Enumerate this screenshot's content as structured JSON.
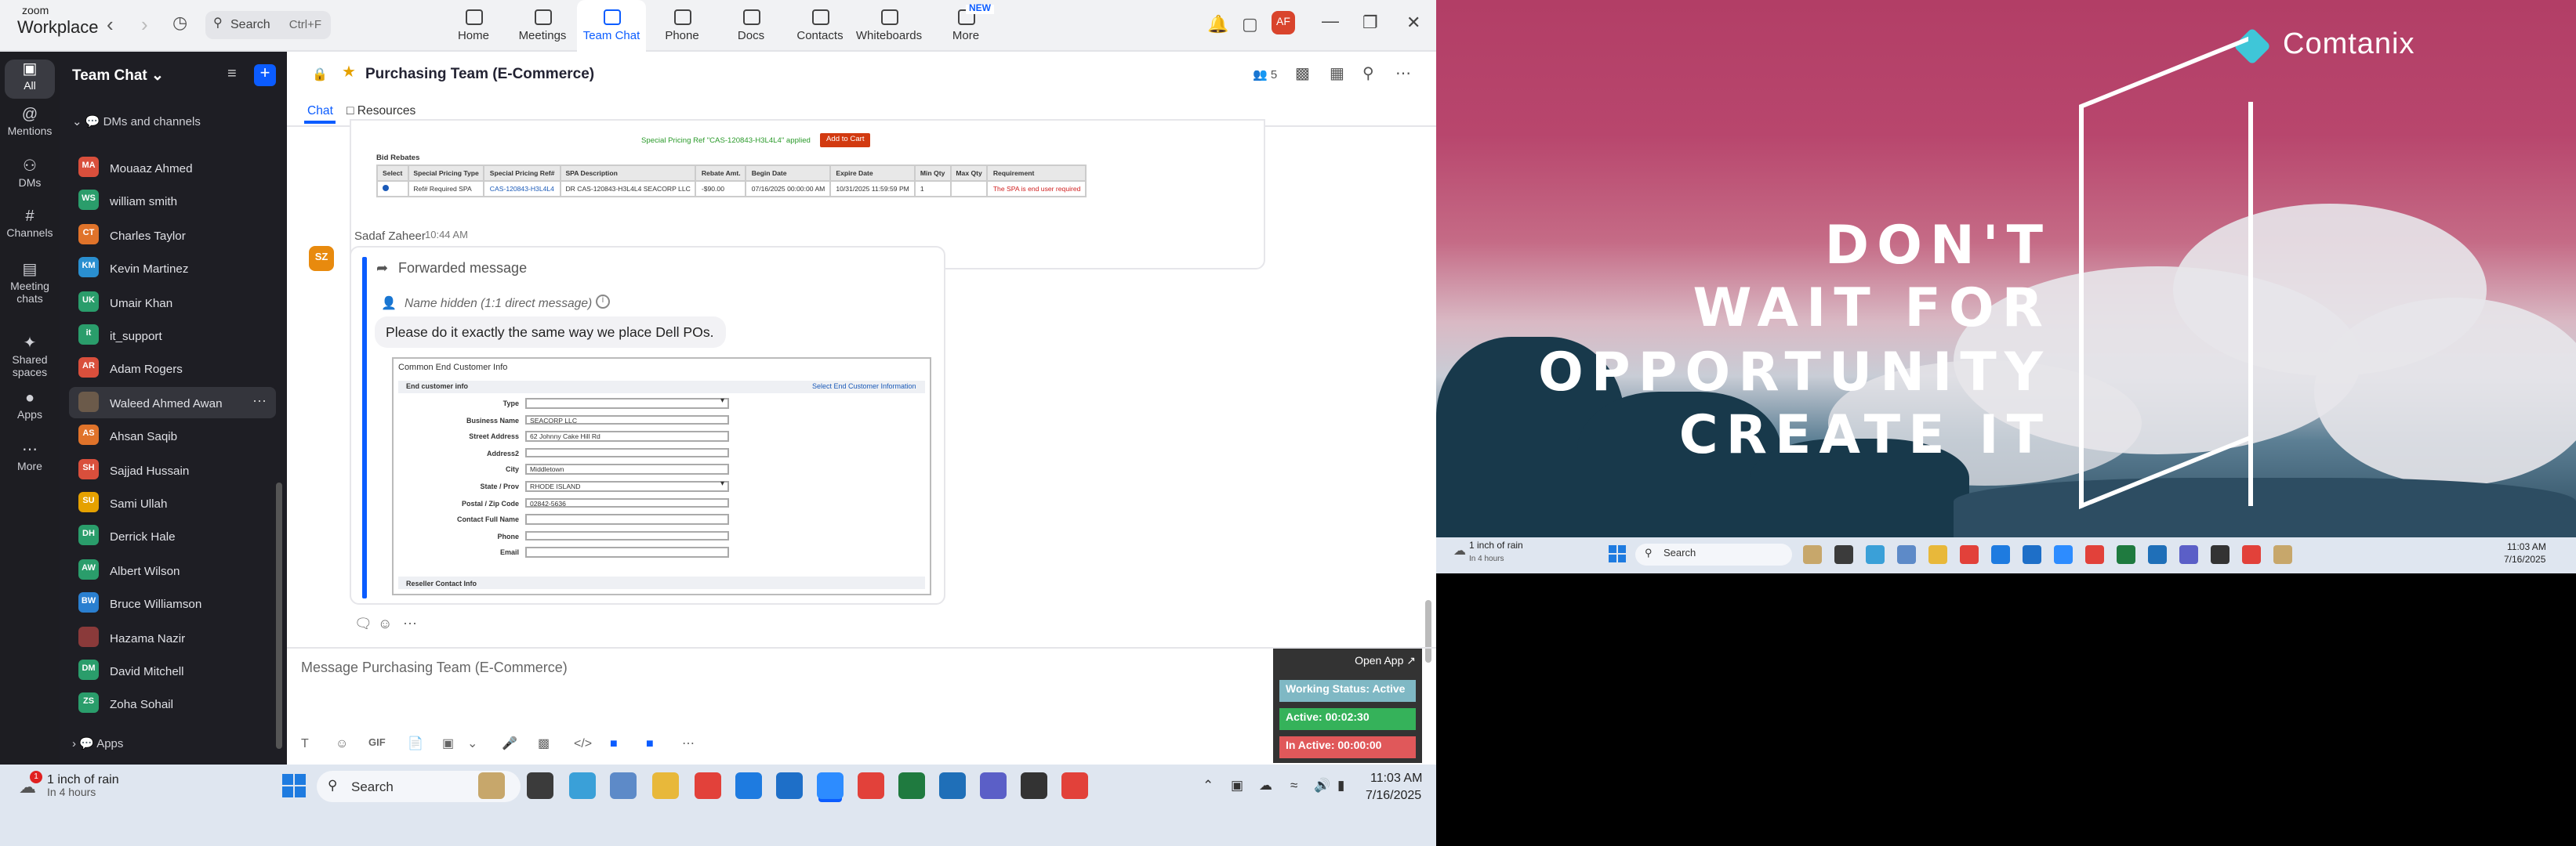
{
  "titlebar": {
    "logo_line1": "zoom",
    "logo_line2": "Workplace",
    "search_placeholder": "Search",
    "search_shortcut": "Ctrl+F",
    "tabs": [
      {
        "label": "Home",
        "icon": "home-icon"
      },
      {
        "label": "Meetings",
        "icon": "video-icon"
      },
      {
        "label": "Team Chat",
        "icon": "chat-icon",
        "active": true
      },
      {
        "label": "Phone",
        "icon": "phone-icon"
      },
      {
        "label": "Docs",
        "icon": "docs-icon"
      },
      {
        "label": "Contacts",
        "icon": "contacts-icon"
      },
      {
        "label": "Whiteboards",
        "icon": "whiteboard-icon"
      },
      {
        "label": "More",
        "icon": "more-icon"
      }
    ],
    "new_badge": "NEW",
    "avatar_initials": "AF"
  },
  "rail": [
    {
      "label": "All",
      "icon": "chat-bubble-icon",
      "active": true
    },
    {
      "label": "Mentions",
      "icon": "at-icon"
    },
    {
      "label": "DMs",
      "icon": "people-icon"
    },
    {
      "label": "Channels",
      "icon": "hash-icon"
    },
    {
      "label": "Meeting chats",
      "icon": "calendar-icon"
    },
    {
      "label": "Shared spaces",
      "icon": "shared-icon"
    },
    {
      "label": "Apps",
      "icon": "apps-icon"
    },
    {
      "label": "More",
      "icon": "more-icon"
    }
  ],
  "sidebar": {
    "title": "Team Chat",
    "section": "DMs and channels",
    "apps_label": "Apps",
    "items": [
      {
        "name": "Mouaaz Ahmed",
        "initials": "MA",
        "color": "#d94f3c"
      },
      {
        "name": "william smith",
        "initials": "WS",
        "color": "#2a9d6b"
      },
      {
        "name": "Charles Taylor",
        "initials": "CT",
        "color": "#e0732a"
      },
      {
        "name": "Kevin Martinez",
        "initials": "KM",
        "color": "#2a8fd0"
      },
      {
        "name": "Umair Khan",
        "initials": "UK",
        "color": "#2a9d6b"
      },
      {
        "name": "it_support",
        "initials": "it",
        "color": "#2a9d6b"
      },
      {
        "name": "Adam Rogers",
        "initials": "AR",
        "color": "#d94f3c"
      },
      {
        "name": "Waleed Ahmed Awan",
        "initials": "",
        "color": "#6b5a4a",
        "selected": true
      },
      {
        "name": "Ahsan Saqib",
        "initials": "AS",
        "color": "#e0732a"
      },
      {
        "name": "Sajjad Hussain",
        "initials": "SH",
        "color": "#d94f3c"
      },
      {
        "name": "Sami Ullah",
        "initials": "SU",
        "color": "#e5a100"
      },
      {
        "name": "Derrick Hale",
        "initials": "DH",
        "color": "#2a9d6b"
      },
      {
        "name": "Albert Wilson",
        "initials": "AW",
        "color": "#2a9d6b"
      },
      {
        "name": "Bruce Williamson",
        "initials": "BW",
        "color": "#2a7fd0"
      },
      {
        "name": "Hazama Nazir",
        "initials": "",
        "color": "#8a3a3a"
      },
      {
        "name": "David Mitchell",
        "initials": "DM",
        "color": "#2a9d6b"
      },
      {
        "name": "Zoha Sohail",
        "initials": "ZS",
        "color": "#2a9d6b"
      }
    ]
  },
  "chat": {
    "title": "Purchasing Team (E-Commerce)",
    "member_count": "5",
    "tabs": [
      "Chat",
      "Resources"
    ],
    "old_card": {
      "special_pricing": "Special Pricing Ref \"CAS-120843-H3L4L4\" applied",
      "add_to_cart": "Add to Cart",
      "bid_rebates": "Bid Rebates",
      "headers": [
        "Select",
        "Special Pricing Type",
        "Special Pricing Ref#",
        "SPA Description",
        "Rebate Amt.",
        "Begin Date",
        "Expire Date",
        "Min Qty",
        "Max Qty",
        "Requirement"
      ],
      "row": [
        "",
        "Ref# Required SPA",
        "CAS-120843-H3L4L4",
        "DR CAS-120843-H3L4L4 SEACORP LLC",
        "-$90.00",
        "07/16/2025 00:00:00 AM",
        "10/31/2025 11:59:59 PM",
        "1",
        "",
        "The SPA is end user required"
      ]
    },
    "message": {
      "sender": "Sadaf Zaheer",
      "time": "10:44 AM",
      "avatar": "SZ",
      "forwarded_label": "Forwarded message",
      "hidden_name": "Name hidden (1:1 direct message)",
      "text": "Please do it exactly the same way we place Dell POs.",
      "form": {
        "title": "Common End Customer Info",
        "section": "End customer info",
        "link": "Select End Customer Information",
        "fields": [
          {
            "label": "Type",
            "value": "",
            "dropdown": true
          },
          {
            "label": "Business Name",
            "value": "SEACORP LLC"
          },
          {
            "label": "Street Address",
            "value": "62 Johnny Cake Hill Rd"
          },
          {
            "label": "Address2",
            "value": ""
          },
          {
            "label": "City",
            "value": "Middletown"
          },
          {
            "label": "State / Prov",
            "value": "RHODE ISLAND",
            "dropdown": true
          },
          {
            "label": "Postal / Zip Code",
            "value": "02842-5636"
          },
          {
            "label": "Contact Full Name",
            "value": ""
          },
          {
            "label": "Phone",
            "value": ""
          },
          {
            "label": "Email",
            "value": ""
          }
        ],
        "reseller": "Reseller Contact Info"
      }
    },
    "composer_placeholder": "Message Purchasing Team (E-Commerce)",
    "format_gif": "GIF"
  },
  "work_status": {
    "open_app": "Open App ↗",
    "status": "Working Status: Active",
    "active": "Active: 00:02:30",
    "inactive": "In Active: 00:00:00",
    "status_color": "#7fb8c4",
    "active_color": "#35b25a",
    "inactive_color": "#e0585a"
  },
  "taskbar": {
    "weather_line1": "1 inch of rain",
    "weather_line2": "In 4 hours",
    "weather_badge": "1",
    "search": "Search",
    "time": "11:03 AM",
    "date": "7/16/2025"
  },
  "wallpaper": {
    "brand": "Comtanix",
    "quote": [
      "DON'T",
      "WAIT FOR",
      "OPPORTUNITY",
      "CREATE IT"
    ]
  },
  "right_taskbar": {
    "weather_line1": "1 inch of rain",
    "weather_line2": "In 4 hours",
    "search": "Search",
    "time": "11:03 AM",
    "date": "7/16/2025"
  }
}
